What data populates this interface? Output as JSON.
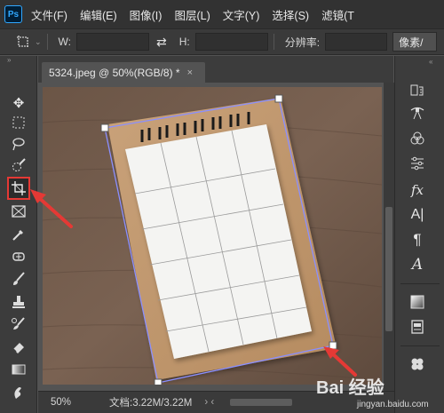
{
  "app": {
    "logo_text": "Ps",
    "menu": [
      "文件(F)",
      "编辑(E)",
      "图像(I)",
      "图层(L)",
      "文字(Y)",
      "选择(S)",
      "滤镜(T"
    ]
  },
  "options_bar": {
    "w_label": "W:",
    "w_value": "",
    "h_label": "H:",
    "h_value": "",
    "resolution_label": "分辨率:",
    "resolution_value": "",
    "units_button": "像素/"
  },
  "document": {
    "tab_title": "5324.jpeg @ 50%(RGB/8) *",
    "close_glyph": "×"
  },
  "status_bar": {
    "zoom": "50%",
    "doc_size": "文档:3.22M/3.22M",
    "nav_arrows": "›   ‹"
  },
  "toolbar": {
    "active_tool": "perspective-crop-tool",
    "tools": [
      "move-icon",
      "marquee-icon",
      "lasso-icon",
      "quick-select-icon",
      "perspective-crop-icon",
      "frame-icon",
      "eyedropper-icon",
      "healing-brush-icon",
      "brush-icon",
      "stamp-icon",
      "history-brush-icon",
      "eraser-icon",
      "gradient-icon",
      "smudge-icon"
    ]
  },
  "right_panel": {
    "tools": [
      "history-icon",
      "paths-icon",
      "channels-icon",
      "adjustments-icon",
      "styles-icon",
      "character-icon",
      "paragraph-icon",
      "glyphs-icon",
      "swatches-icon",
      "properties-icon",
      "color-wheel-icon"
    ],
    "labels": {
      "styles": "fx",
      "character": "A|",
      "paragraph": "¶",
      "glyphs": "A"
    }
  },
  "colors": {
    "annotation_arrow": "#e53935",
    "selection_outline": "#8a8fff",
    "ui_dark": "#323232",
    "canvas_bg": "#535353"
  },
  "watermark": {
    "main": "Bai 经验",
    "sub": "jingyan.baidu.com"
  }
}
